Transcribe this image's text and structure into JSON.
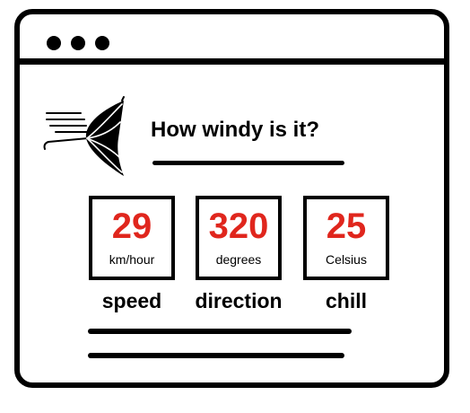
{
  "window": {
    "controls": [
      "window-dot",
      "window-dot",
      "window-dot"
    ]
  },
  "header": {
    "icon": "windy-umbrella-icon",
    "title": "How windy is it?"
  },
  "metrics": [
    {
      "value": "29",
      "unit": "km/hour",
      "label": "speed"
    },
    {
      "value": "320",
      "unit": "degrees",
      "label": "direction"
    },
    {
      "value": "25",
      "unit": "Celsius",
      "label": "chill"
    }
  ],
  "colors": {
    "accent": "#e0261d",
    "line": "#000000",
    "background": "#ffffff"
  }
}
